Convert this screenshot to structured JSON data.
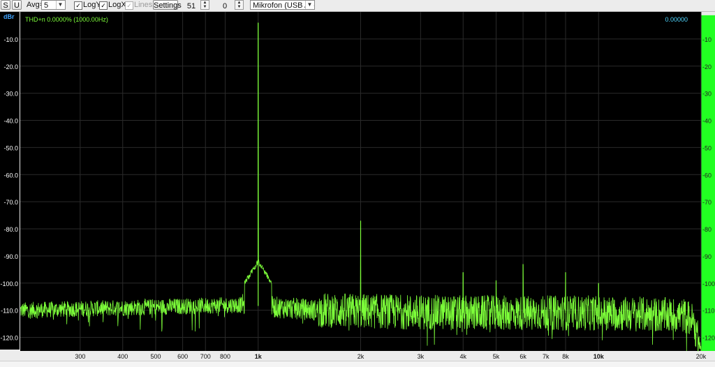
{
  "toolbar": {
    "s_label": "S",
    "u_label": "U",
    "avg_label": "Avg=",
    "avg_value": "5",
    "logy_label": "LogY",
    "logx_label": "LogX",
    "lines_label": "Lines",
    "settings_label": "Settings",
    "stepper_a_value": "51",
    "stepper_b_value": "0",
    "input_device": "Mikrofon (USB Audi"
  },
  "colors": {
    "plot_bg": "#000000",
    "trace": "#7dff3a",
    "grid": "#2a2a2a",
    "axis_text": "#ffffff",
    "thd_text": "#7dff3a",
    "value_text": "#4fd6ff",
    "level_bar": "#22ff22",
    "axis_bg": "#ececec"
  },
  "chart_data": {
    "type": "line",
    "title": "",
    "xlabel": "",
    "ylabel": "dBr",
    "x_scale": "log",
    "xlim": [
      200,
      20000
    ],
    "ylim": [
      -125,
      0
    ],
    "grid": true,
    "readout_left": "THD+n 0.0000% (1000.00Hz)",
    "readout_right": "0.00000",
    "y_ticks": [
      -10,
      -20,
      -30,
      -40,
      -50,
      -60,
      -70,
      -80,
      -90,
      -100,
      -110,
      -120
    ],
    "y_tick_labels_left": [
      "-10.0",
      "-20.0",
      "-30.0",
      "-40.0",
      "-50.0",
      "-60.0",
      "-70.0",
      "-80.0",
      "-90.0",
      "-100.0",
      "-110.0",
      "-120.0"
    ],
    "y_tick_labels_right": [
      "-10",
      "-20",
      "-30",
      "-40",
      "-50",
      "-60",
      "-70",
      "-80",
      "-90",
      "-100",
      "-110",
      "-120"
    ],
    "x_ticks": [
      {
        "f": 300,
        "label": "300",
        "major": false
      },
      {
        "f": 400,
        "label": "400",
        "major": false
      },
      {
        "f": 500,
        "label": "500",
        "major": false
      },
      {
        "f": 600,
        "label": "600",
        "major": false
      },
      {
        "f": 700,
        "label": "700",
        "major": false
      },
      {
        "f": 800,
        "label": "800",
        "major": false
      },
      {
        "f": 1000,
        "label": "1k",
        "major": true
      },
      {
        "f": 2000,
        "label": "2k",
        "major": false
      },
      {
        "f": 3000,
        "label": "3k",
        "major": false
      },
      {
        "f": 4000,
        "label": "4k",
        "major": false
      },
      {
        "f": 5000,
        "label": "5k",
        "major": false
      },
      {
        "f": 6000,
        "label": "6k",
        "major": false
      },
      {
        "f": 7000,
        "label": "7k",
        "major": false
      },
      {
        "f": 8000,
        "label": "8k",
        "major": false
      },
      {
        "f": 10000,
        "label": "10k",
        "major": true
      },
      {
        "f": 20000,
        "label": "20k",
        "major": false
      }
    ],
    "series": [
      {
        "noise_floor": [
          [
            200,
            -110
          ],
          [
            900,
            -108
          ],
          [
            1500,
            -110
          ],
          [
            4000,
            -111
          ],
          [
            10000,
            -111
          ],
          [
            18000,
            -112
          ],
          [
            19000,
            -114
          ],
          [
            20000,
            -125
          ]
        ],
        "peaks": [
          {
            "f": 1000,
            "db": -4
          },
          {
            "f": 2000,
            "db": -77
          },
          {
            "f": 4000,
            "db": -96
          },
          {
            "f": 5000,
            "db": -99
          },
          {
            "f": 6000,
            "db": -93
          },
          {
            "f": 8000,
            "db": -96
          },
          {
            "f": 10000,
            "db": -100
          }
        ]
      }
    ],
    "level_bar_value": 0.99
  }
}
